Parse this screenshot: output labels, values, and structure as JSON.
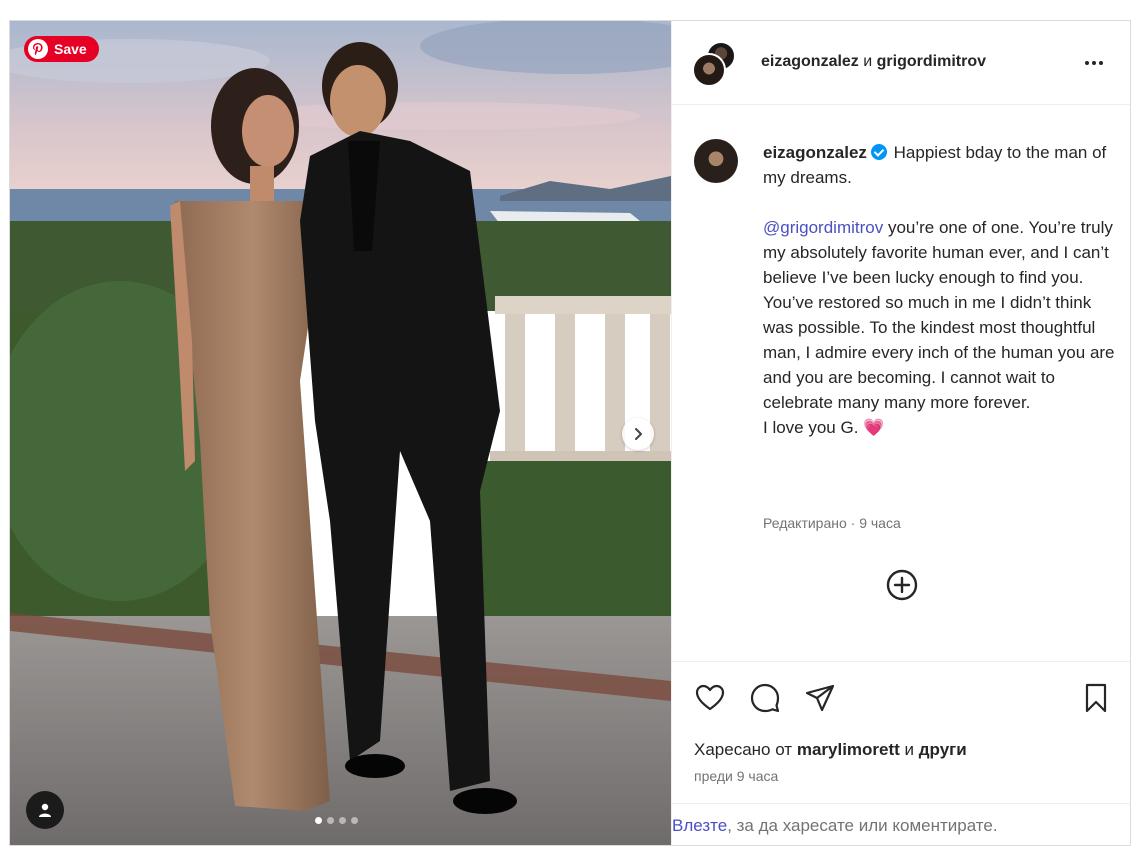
{
  "photo": {
    "save_label": "Save",
    "carousel_dots": 4,
    "active_dot": 1
  },
  "header": {
    "user1": "eizagonzalez",
    "joiner": "и",
    "user2": "grigordimitrov"
  },
  "caption": {
    "username": "eizagonzalez",
    "line1": " Happiest bday to the man of my dreams.",
    "mention": "@grigordimitrov",
    "body": " you’re one of one. You’re truly my absolutely favorite human ever, and I can’t believe I’ve been lucky enough to find you. You’ve restored so much in me I didn’t think was possible. To the kindest most thoughtful man, I admire every inch of the human you are and you are becoming. I cannot wait to celebrate many many more forever.",
    "closing": "I love you G. ",
    "heart": "💗",
    "meta": "Редактирано · 9 часа"
  },
  "likes": {
    "prefix": "Харесано от ",
    "user": "marylimorett",
    "joiner": " и ",
    "others": "други"
  },
  "time_ago": "преди 9 часа",
  "login": {
    "link": "Влезте",
    "rest": ", за да харесате или коментирате."
  },
  "colors": {
    "pinterest_red": "#e60023",
    "verified_blue": "#0095f6",
    "link_blue": "#4a4fc3"
  }
}
